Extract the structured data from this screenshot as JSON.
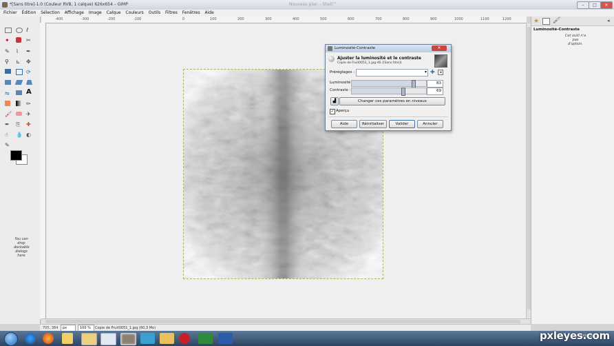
{
  "window": {
    "title": "*[Sans titre]-1.0 (Couleur RVB, 1 calque) 626x654 – GIMP",
    "ghost_title": "Nouveau plan – Shell™",
    "btn_min": "–",
    "btn_max": "□",
    "btn_close": "✕"
  },
  "menu": [
    "Fichier",
    "Édition",
    "Sélection",
    "Affichage",
    "Image",
    "Calque",
    "Couleurs",
    "Outils",
    "Filtres",
    "Fenêtres",
    "Aide"
  ],
  "toolbox": {
    "drop_hint": "You can drop dockable dialogs here"
  },
  "ruler": {
    "ticks": [
      "-400",
      "-300",
      "-200",
      "-100",
      "0",
      "100",
      "200",
      "300",
      "400",
      "500",
      "600",
      "700",
      "800",
      "900",
      "1000",
      "1100",
      "1200",
      "1300"
    ]
  },
  "status": {
    "coords": "705, 384",
    "unit": "px",
    "zoom": "100 %",
    "info": "Copie de Fruit0051_1.jpg (60,3 Mo)"
  },
  "dock": {
    "title": "Luminosité-Contraste",
    "empty": "Cet outil n'a pas d'option."
  },
  "dialog": {
    "title": "Luminosité-Contraste",
    "heading": "Ajuster la luminosité et le contraste",
    "subheading": "Copie de Fruit0051_1.jpg-46 ([Sans titre])",
    "presets_label": "Préréglages :",
    "brightness_label": "Luminosité :",
    "brightness_value": "83",
    "brightness_fraction": 0.83,
    "contrast_label": "Contraste :",
    "contrast_value": "69",
    "contrast_fraction": 0.69,
    "levels_button": "Changer ces paramètres en niveaux",
    "preview_label": "Aperçu",
    "btn_help": "Aide",
    "btn_reset": "Réinitialiser",
    "btn_ok": "Valider",
    "btn_cancel": "Annuler"
  },
  "taskbar": {
    "date": "18/05/2013"
  },
  "watermark": "pxleyes.com",
  "colors": {
    "accent": "#3a6ea5",
    "fg_color": "#000000",
    "bg_color": "#ffffff"
  }
}
